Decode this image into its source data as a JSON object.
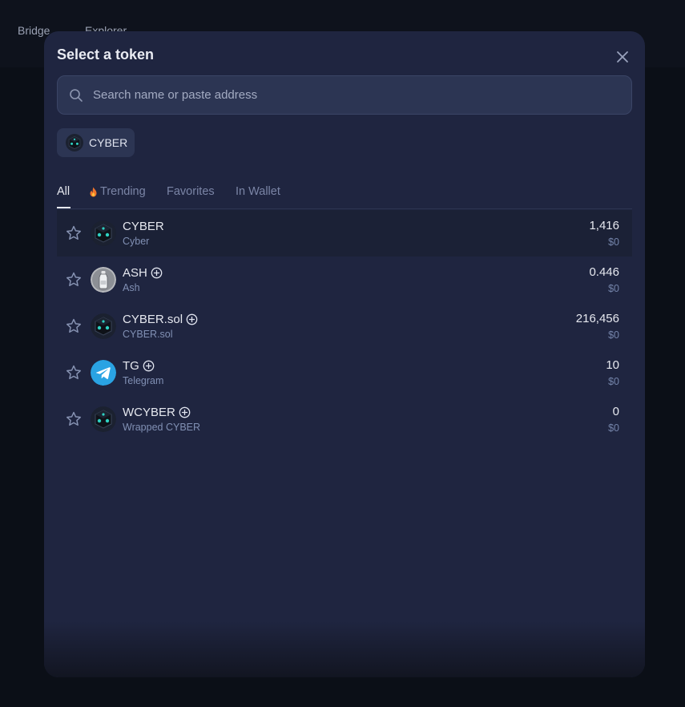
{
  "nav": {
    "bridge": "Bridge",
    "explorer": "Explorer"
  },
  "modal": {
    "title": "Select a token",
    "close_icon": "close-icon",
    "search": {
      "placeholder": "Search name or paste address",
      "value": "",
      "icon": "search-icon"
    },
    "chip": {
      "label": "CYBER",
      "icon": "cyber-logo"
    },
    "tabs": [
      {
        "label": "All",
        "active": true
      },
      {
        "label": "Trending",
        "icon": "fire-icon"
      },
      {
        "label": "Favorites"
      },
      {
        "label": "In Wallet"
      }
    ],
    "tokens": [
      {
        "symbol": "CYBER",
        "name": "Cyber",
        "balance": "1,416",
        "usd": "$0",
        "logo": "cyber-logo",
        "addable": false
      },
      {
        "symbol": "ASH",
        "name": "Ash",
        "balance": "0.446",
        "usd": "$0",
        "logo": "ash-logo",
        "addable": true
      },
      {
        "symbol": "CYBER.sol",
        "name": "CYBER.sol",
        "balance": "216,456",
        "usd": "$0",
        "logo": "cyber-logo",
        "addable": true
      },
      {
        "symbol": "TG",
        "name": "Telegram",
        "balance": "10",
        "usd": "$0",
        "logo": "telegram-logo",
        "addable": true
      },
      {
        "symbol": "WCYBER",
        "name": "Wrapped CYBER",
        "balance": "0",
        "usd": "$0",
        "logo": "cyber-logo",
        "addable": true
      }
    ]
  },
  "colors": {
    "modal_bg": "#1f2540",
    "accent_telegram": "#2aa3e3",
    "cyber_teal": "#2ed1c2"
  }
}
